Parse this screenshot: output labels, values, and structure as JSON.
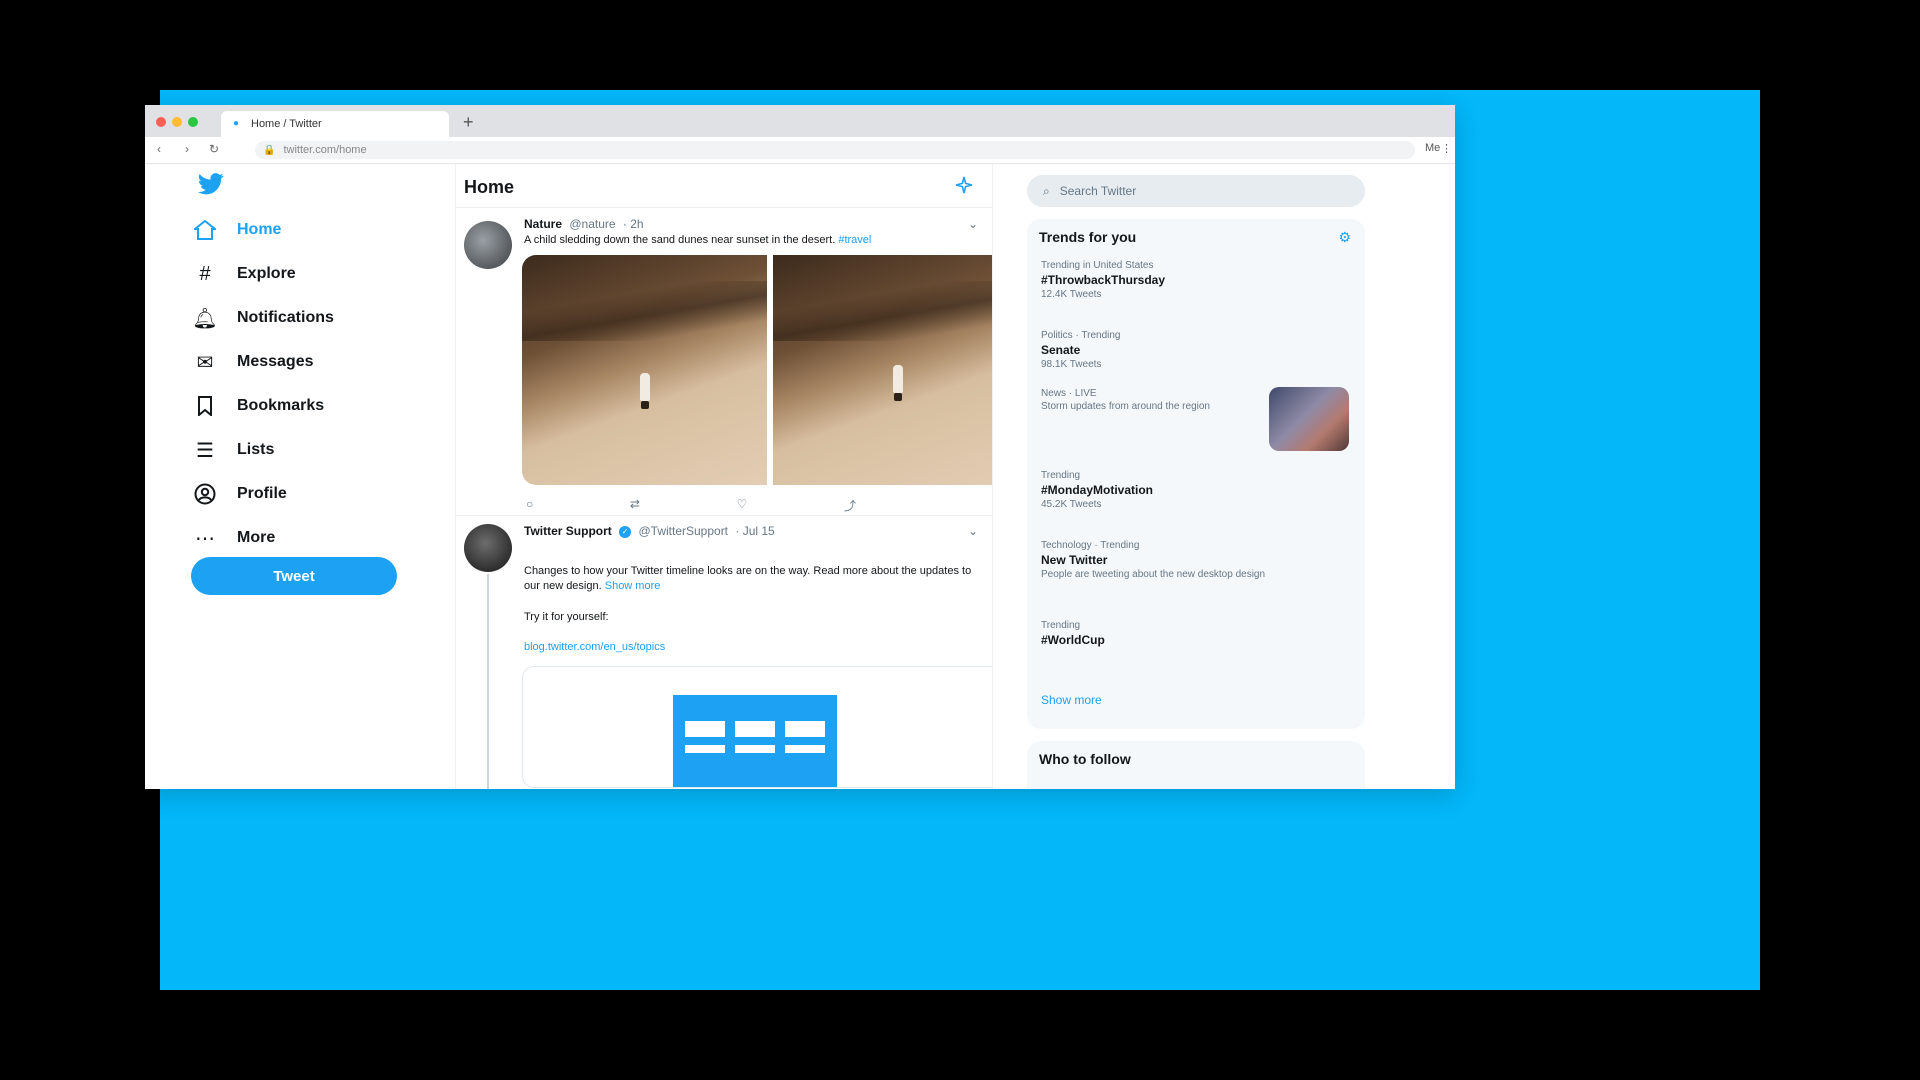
{
  "browser": {
    "tab_title": "Home / Twitter",
    "new_tab": "+",
    "url": "twitter.com/home",
    "back": "‹",
    "forward": "›",
    "reload": "↻",
    "profile": "Me",
    "menu": "⋮",
    "light_colors": [
      "#ff5f57",
      "#febc2e",
      "#28c840"
    ]
  },
  "sidebar": {
    "items": [
      {
        "label": "Home",
        "icon": "home-icon"
      },
      {
        "label": "Explore",
        "icon": "hashtag-icon"
      },
      {
        "label": "Notifications",
        "icon": "bell-icon"
      },
      {
        "label": "Messages",
        "icon": "envelope-icon"
      },
      {
        "label": "Bookmarks",
        "icon": "bookmark-icon"
      },
      {
        "label": "Lists",
        "icon": "list-icon"
      },
      {
        "label": "Profile",
        "icon": "profile-icon"
      },
      {
        "label": "More",
        "icon": "more-icon"
      }
    ],
    "tweet_button": "Tweet"
  },
  "main": {
    "title": "Home",
    "tweets": [
      {
        "name": "Nature",
        "handle": "@nature",
        "time": "· 2h",
        "text": "A child sledding down the sand dunes near sunset in the desert.",
        "link": "#travel",
        "more": "⌄"
      },
      {
        "name": "Twitter Support",
        "handle": "@TwitterSupport",
        "time": "· Jul 15",
        "text": "Changes to how your Twitter timeline looks are on the way. Read more about the updates to our new design.",
        "link": "Show more",
        "line2": "Try it for yourself:",
        "url": "blog.twitter.com/en_us/topics",
        "more": "⌄"
      }
    ],
    "actions": [
      "○",
      "⇄",
      "♡",
      "⤴"
    ]
  },
  "right": {
    "search_placeholder": "Search Twitter",
    "trends_title": "Trends for you",
    "trends": [
      {
        "category": "Trending in United States",
        "title": "#ThrowbackThursday",
        "desc": "",
        "count": "12.4K Tweets"
      },
      {
        "category": "Politics · Trending",
        "title": "Senate",
        "desc": "",
        "count": "98.1K Tweets"
      },
      {
        "category": "News · LIVE",
        "title": "",
        "desc": "Storm updates from around the region",
        "count": ""
      },
      {
        "category": "Trending",
        "title": "#MondayMotivation",
        "desc": "",
        "count": "45.2K Tweets"
      },
      {
        "category": "Technology · Trending",
        "title": "New Twitter",
        "desc": "People are tweeting about the new desktop design",
        "count": ""
      },
      {
        "category": "Trending",
        "title": "#WorldCup",
        "desc": "",
        "count": ""
      }
    ],
    "show_more": "Show more",
    "who_to_follow": "Who to follow"
  },
  "colors": {
    "brand": "#1da1f2",
    "stage": "#03b7f9"
  }
}
